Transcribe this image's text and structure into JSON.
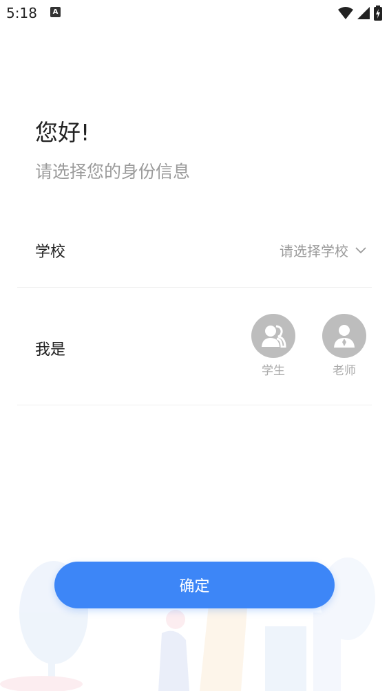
{
  "status_bar": {
    "time": "5:18",
    "notification_icon": "a-icon"
  },
  "header": {
    "greeting": "您好!",
    "subtitle": "请选择您的身份信息"
  },
  "form": {
    "school": {
      "label": "学校",
      "placeholder": "请选择学校",
      "icon": "chevron-down-icon"
    },
    "role": {
      "label": "我是",
      "options": [
        {
          "label": "学生",
          "icon": "student-icon"
        },
        {
          "label": "老师",
          "icon": "teacher-icon"
        }
      ]
    }
  },
  "footer": {
    "confirm_label": "确定"
  },
  "colors": {
    "accent": "#3d86f7",
    "avatar_gray": "#bdbdbd",
    "muted_text": "#9b9b9b"
  }
}
